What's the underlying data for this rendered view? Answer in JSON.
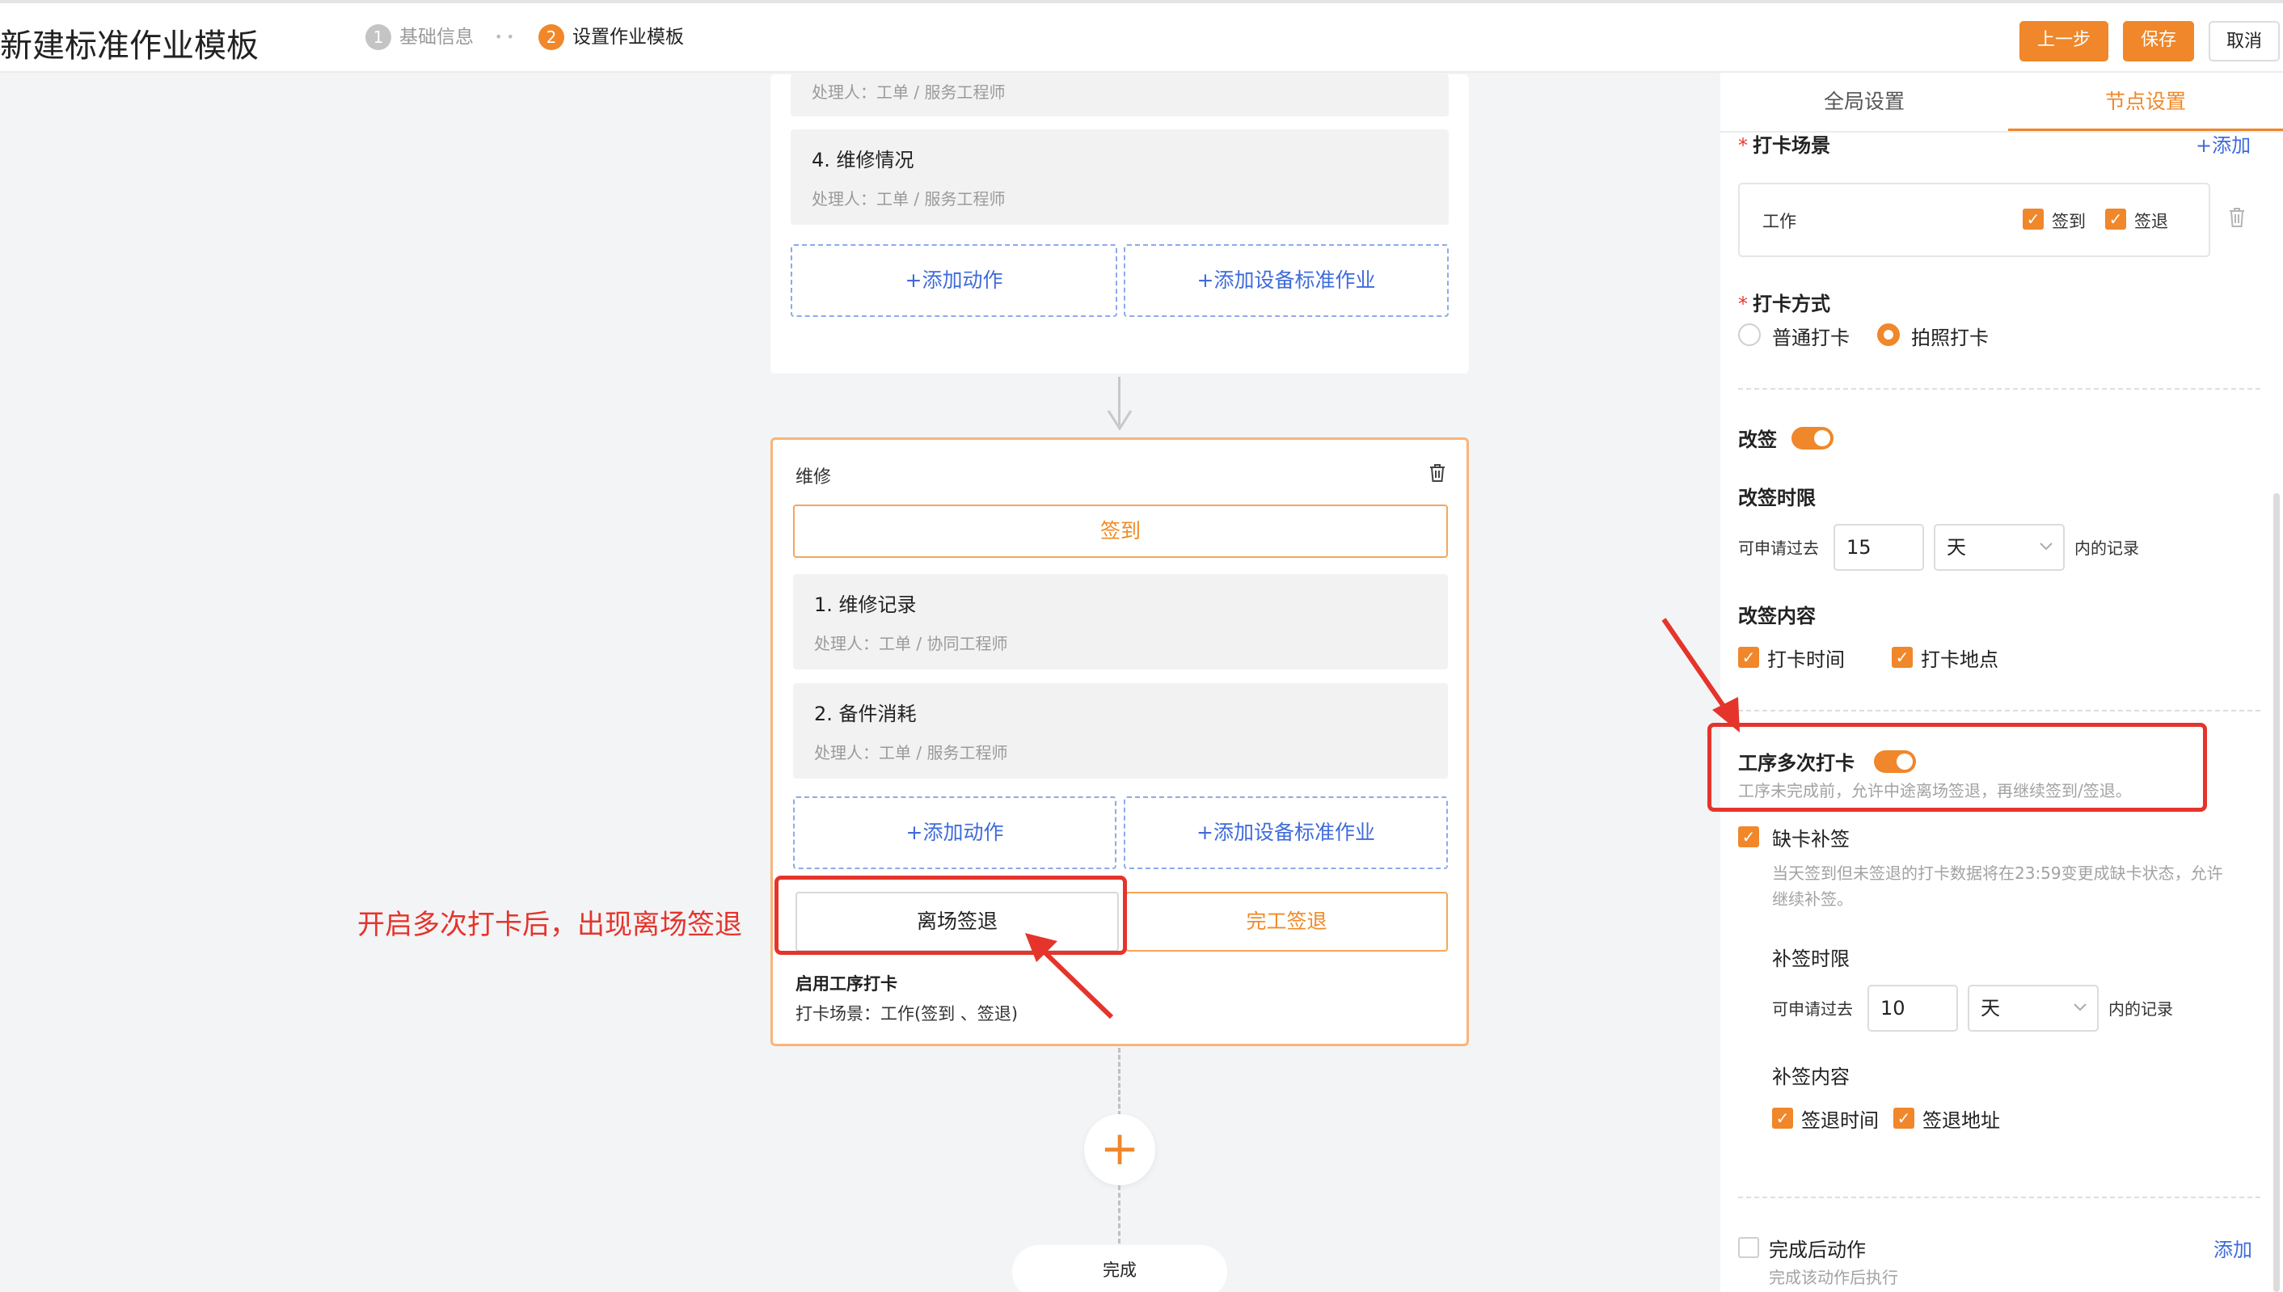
{
  "header": {
    "title": "新建标准作业模板",
    "steps": [
      {
        "num": "1",
        "label": "基础信息"
      },
      {
        "num": "2",
        "label": "设置作业模板"
      }
    ],
    "step_separator": "• •",
    "buttons": {
      "prev": "上一步",
      "save": "保存",
      "cancel": "取消"
    }
  },
  "canvas": {
    "top_card": {
      "partial_item_sub": "处理人：工单 / 服务工程师",
      "item4": {
        "title": "4. 维修情况",
        "sub": "处理人：工单 / 服务工程师"
      },
      "add_action": "+添加动作",
      "add_std": "+添加设备标准作业"
    },
    "repair_card": {
      "title": "维修",
      "checkin": "签到",
      "items": [
        {
          "title": "1. 维修记录",
          "sub": "处理人：工单 / 协同工程师"
        },
        {
          "title": "2. 备件消耗",
          "sub": "处理人：工单 / 服务工程师"
        }
      ],
      "add_action": "+添加动作",
      "add_std": "+添加设备标准作业",
      "leave_checkout": "离场签退",
      "finish_checkout": "完工签退",
      "enable_label": "启用工序打卡",
      "scene_text": "打卡场景：工作(签到 、签退)"
    },
    "add_node": "+",
    "finish": "完成"
  },
  "annotation": {
    "text": "开启多次打卡后，出现离场签退"
  },
  "panel": {
    "tabs": [
      "全局设置",
      "节点设置"
    ],
    "active_tab": 1,
    "scene": {
      "label": "打卡场景",
      "required": "*",
      "add": "+添加",
      "row_name": "工作",
      "checkin": "签到",
      "checkout": "签退"
    },
    "method": {
      "label": "打卡方式",
      "required": "*",
      "options": [
        "普通打卡",
        "拍照打卡"
      ],
      "selected": "拍照打卡"
    },
    "resign": {
      "label": "改签",
      "enabled": true
    },
    "resign_limit": {
      "label": "改签时限",
      "prefix": "可申请过去",
      "value": "15",
      "unit": "天",
      "suffix": "内的记录"
    },
    "resign_content": {
      "label": "改签内容",
      "options": [
        "打卡时间",
        "打卡地点"
      ]
    },
    "multi": {
      "label": "工序多次打卡",
      "enabled": true,
      "desc": "工序未完成前，允许中途离场签退，再继续签到/签退。"
    },
    "makeup": {
      "label": "缺卡补签",
      "checked": true,
      "desc1": "当天签到但未签退的打卡数据将在23:59变更成缺卡状态，允许",
      "desc2": "继续补签。",
      "limit_label": "补签时限",
      "prefix": "可申请过去",
      "value": "10",
      "unit": "天",
      "suffix": "内的记录",
      "content_label": "补签内容",
      "options": [
        "签退时间",
        "签退地址"
      ]
    },
    "after": {
      "label": "完成后动作",
      "checked": false,
      "add": "添加",
      "desc": "完成该动作后执行"
    }
  },
  "colors": {
    "accent": "#f0872a",
    "link": "#3f6bdb",
    "annotation": "#e5342b"
  }
}
